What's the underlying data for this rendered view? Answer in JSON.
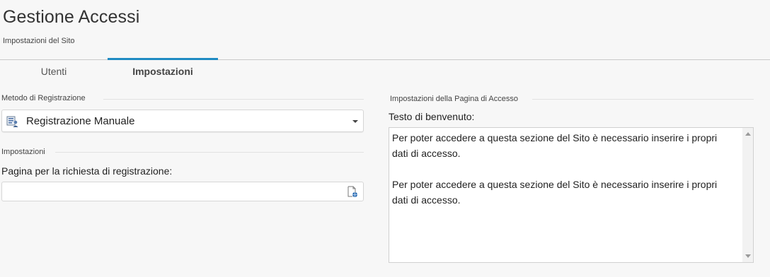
{
  "header": {
    "title": "Gestione Accessi",
    "subtitle": "Impostazioni del Sito"
  },
  "tabs": [
    {
      "label": "Utenti",
      "active": false
    },
    {
      "label": "Impostazioni",
      "active": true
    }
  ],
  "accent_color": "#1f8bc3",
  "left": {
    "registration_method": {
      "section_label": "Metodo di Registrazione",
      "selected_value": "Registrazione Manuale",
      "icon": "user-list-icon"
    },
    "settings": {
      "section_label": "Impostazioni",
      "registration_page_label": "Pagina per la richiesta di registrazione:",
      "registration_page_value": "",
      "picker_icon": "page-link-icon"
    }
  },
  "right": {
    "section_label": "Impostazioni della Pagina di Accesso",
    "welcome_label": "Testo di benvenuto:",
    "welcome_text": "Per poter accedere a questa sezione del Sito è necessario inserire i propri dati di accesso.\n\nPer poter accedere a questa sezione del Sito è necessario inserire i propri dati di accesso."
  }
}
